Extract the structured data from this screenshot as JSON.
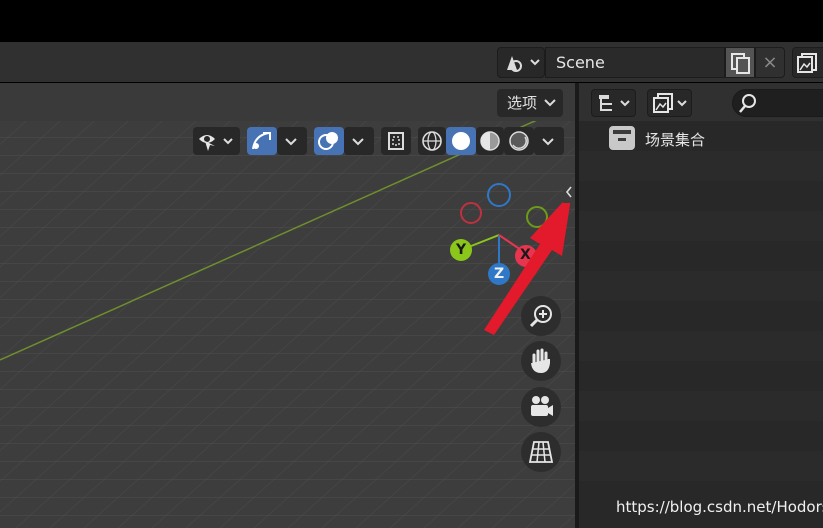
{
  "scene": {
    "name": "Scene",
    "close_glyph": "×"
  },
  "viewport": {
    "options_label": "选项",
    "toolbar_icons": [
      "visibility-icon",
      "gizmo-icon",
      "overlay-icon",
      "xray-icon",
      "wireframe-shading-icon",
      "solid-shading-icon",
      "material-shading-icon",
      "rendered-shading-icon"
    ],
    "gizmo_axes": {
      "y": "Y",
      "z": "Z",
      "x": "X"
    },
    "nav_buttons": [
      "zoom-icon",
      "pan-hand-icon",
      "camera-icon",
      "perspective-grid-icon"
    ]
  },
  "outliner": {
    "collection_label": "场景集合"
  },
  "watermark": "https://blog.csdn.net/Hodors",
  "colors": {
    "accent_blue": "#4772b3",
    "axis_x": "#e8354f",
    "axis_y": "#8bc71b",
    "axis_z": "#2f78c7",
    "annotation_red": "#e21a2b"
  }
}
